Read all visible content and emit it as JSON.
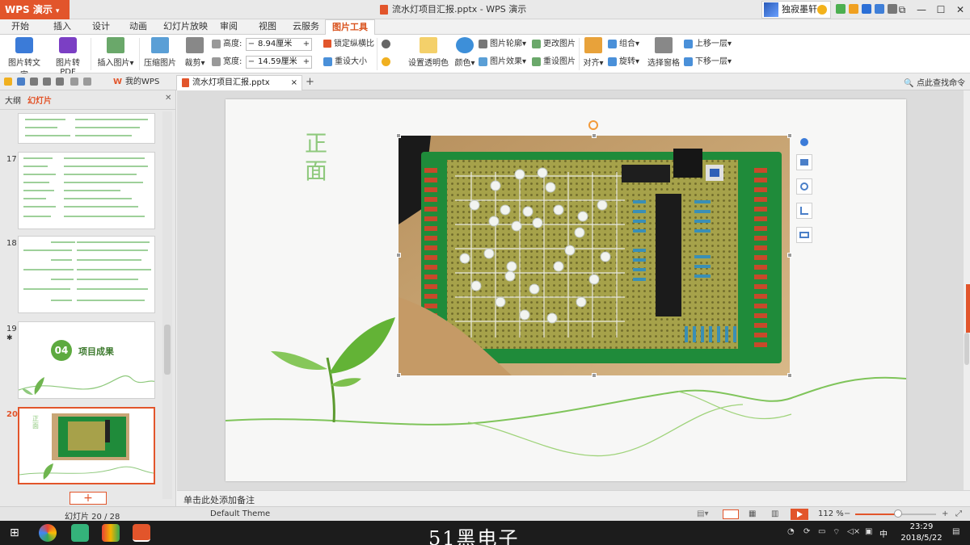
{
  "app": {
    "name": "WPS 演示",
    "window_title": "流水灯项目汇报.pptx - WPS 演示",
    "user_name": "独寂墨轩"
  },
  "menu": {
    "tabs": [
      "开始",
      "插入",
      "设计",
      "动画",
      "幻灯片放映",
      "审阅",
      "视图",
      "云服务",
      "图片工具"
    ],
    "active": "图片工具"
  },
  "ribbon": {
    "pic_to_text": "图片转文字",
    "pic_to_pdf": "图片转PDF",
    "insert_pic": "插入图片",
    "compress_pic": "压缩图片",
    "crop": "裁剪",
    "height_label": "高度:",
    "height_value": "8.94厘米",
    "width_label": "宽度:",
    "width_value": "14.59厘米",
    "lock_ratio": "锁定纵横比",
    "reset_size": "重设大小",
    "set_transparent": "设置透明色",
    "color": "颜色",
    "pic_outline": "图片轮廓",
    "pic_effect": "图片效果",
    "change_pic": "更改图片",
    "reset_pic": "重设图片",
    "align": "对齐",
    "group": "组合",
    "rotate": "旋转",
    "selection_pane": "选择窗格",
    "bring_forward": "上移一层",
    "send_backward": "下移一层"
  },
  "doc_tabs": {
    "home": "我的WPS",
    "current": "流水灯项目汇报.pptx",
    "search_cmd": "点此查找命令"
  },
  "left_panel": {
    "tab_outline": "大纲",
    "tab_slides": "幻灯片",
    "slides": [
      {
        "num": "17"
      },
      {
        "num": "18"
      },
      {
        "num": "19",
        "title_badge": "04",
        "title": "项目成果"
      },
      {
        "num": "20"
      }
    ]
  },
  "slide": {
    "title": "正面"
  },
  "notes_placeholder": "单击此处添加备注",
  "status": {
    "slide_counter": "幻灯片 20 / 28",
    "theme": "Default Theme",
    "zoom": "112 %"
  },
  "taskbar": {
    "watermark": "51黑电子",
    "ime": "中",
    "time": "23:29",
    "date": "2018/5/22"
  },
  "colors": {
    "accent": "#e2552b",
    "pcb_green": "#1f8b3a",
    "leaf_green": "#8fc97d"
  }
}
